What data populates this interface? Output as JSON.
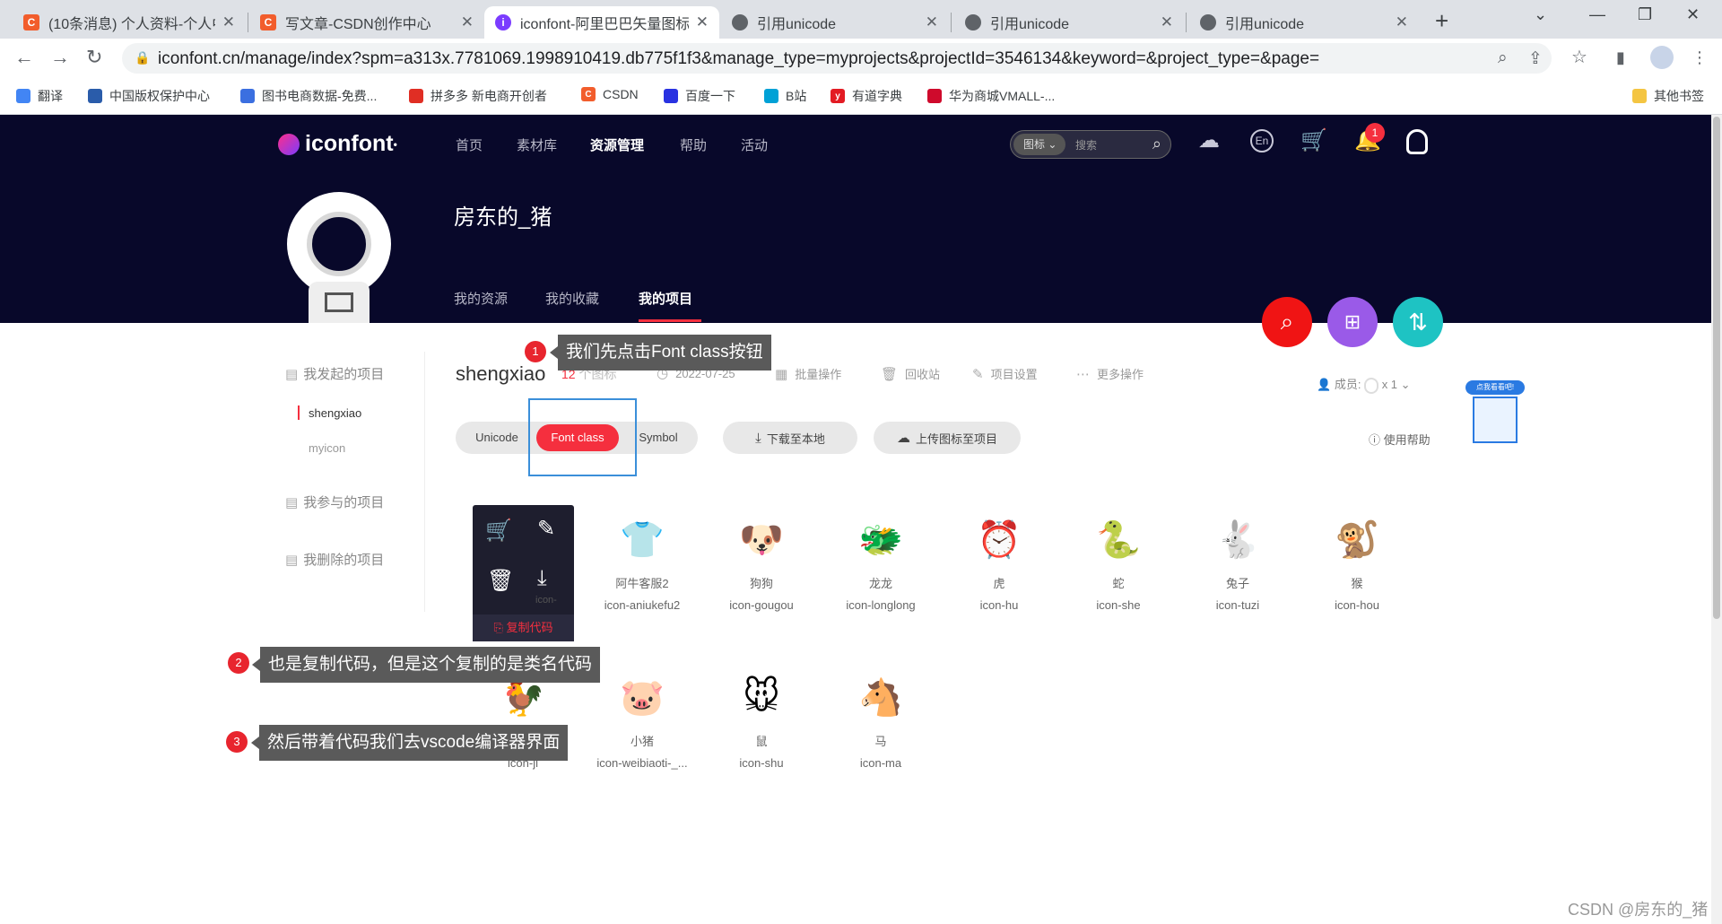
{
  "browser": {
    "tabs": [
      {
        "title": "(10条消息) 个人资料-个人中",
        "favicon": "C",
        "color": "#f25d2c"
      },
      {
        "title": "写文章-CSDN创作中心",
        "favicon": "C",
        "color": "#f25d2c"
      },
      {
        "title": "iconfont-阿里巴巴矢量图标",
        "favicon": "i",
        "color": "#7b3cff"
      },
      {
        "title": "引用unicode",
        "favicon": "globe",
        "color": "#5f6368"
      },
      {
        "title": "引用unicode",
        "favicon": "globe",
        "color": "#5f6368"
      },
      {
        "title": "引用unicode",
        "favicon": "globe",
        "color": "#5f6368"
      }
    ],
    "url": "iconfont.cn/manage/index?spm=a313x.7781069.1998910419.db775f1f3&manage_type=myprojects&projectId=3546134&keyword=&project_type=&page=",
    "bookmarks": [
      {
        "label": "翻译",
        "color": "#4285f4"
      },
      {
        "label": "中国版权保护中心",
        "color": "#2a5caa"
      },
      {
        "label": "图书电商数据-免费...",
        "color": "#3b6fe0"
      },
      {
        "label": "拼多多 新电商开创者",
        "color": "#e02e24"
      },
      {
        "label": "CSDN",
        "color": "#f25d2c"
      },
      {
        "label": "百度一下",
        "color": "#2932e1"
      },
      {
        "label": "B站",
        "color": "#00a1d6"
      },
      {
        "label": "有道字典",
        "color": "#e31b23"
      },
      {
        "label": "华为商城VMALL-...",
        "color": "#cf0a2c"
      }
    ],
    "other_bookmarks": "其他书签"
  },
  "site": {
    "logo": "iconfont",
    "nav": [
      "首页",
      "素材库",
      "资源管理",
      "帮助",
      "活动"
    ],
    "search_type": "图标",
    "search_placeholder": "搜索",
    "notification_count": "1",
    "username": "房东的_猪",
    "subtabs": [
      "我的资源",
      "我的收藏",
      "我的项目"
    ]
  },
  "sidebar": {
    "my_projects_header": "我发起的项目",
    "projects": [
      "shengxiao",
      "myicon"
    ],
    "joined_header": "我参与的项目",
    "deleted_header": "我删除的项目"
  },
  "project": {
    "name": "shengxiao",
    "count": "12",
    "count_unit": "个图标",
    "date": "2022-07-25",
    "actions": [
      "批量操作",
      "回收站",
      "项目设置",
      "更多操作"
    ],
    "members_label": "成员:",
    "members_count": "x 1",
    "help_badge": "点我看看吧!",
    "help_link": "使用帮助",
    "format_tabs": [
      "Unicode",
      "Font class",
      "Symbol"
    ],
    "download": "下载至本地",
    "upload": "上传图标至项目",
    "copy_code": "复制代码",
    "hidden_icon_code": "icon-"
  },
  "icons": [
    {
      "name": "阿牛客服2",
      "code": "icon-aniukefu2",
      "glyph": "👕",
      "color": "#555"
    },
    {
      "name": "狗狗",
      "code": "icon-gougou",
      "glyph": "🐶",
      "color": "#444"
    },
    {
      "name": "龙龙",
      "code": "icon-longlong",
      "glyph": "🐲",
      "color": "#4a7a9a"
    },
    {
      "name": "虎",
      "code": "icon-hu",
      "glyph": "⏰",
      "color": "#4aa8e8"
    },
    {
      "name": "蛇",
      "code": "icon-she",
      "glyph": "🐍",
      "color": "#3a7fd4"
    },
    {
      "name": "兔子",
      "code": "icon-tuzi",
      "glyph": "🐇",
      "color": "#6a7478"
    },
    {
      "name": "猴",
      "code": "icon-hou",
      "glyph": "🐒",
      "color": "#9a5a2a"
    },
    {
      "name": "鸡",
      "code": "icon-ji",
      "glyph": "🐓",
      "color": "#888"
    },
    {
      "name": "小猪",
      "code": "icon-weibiaoti-_...",
      "glyph": "🐷",
      "color": "#5cb85c"
    },
    {
      "name": "鼠",
      "code": "icon-shu",
      "glyph": "🐭",
      "color": "#e02020"
    },
    {
      "name": "马",
      "code": "icon-ma",
      "glyph": "🐴",
      "color": "#7a5ac8"
    }
  ],
  "annotations": [
    {
      "num": "1",
      "text": "我们先点击Font class按钮"
    },
    {
      "num": "2",
      "text": "也是复制代码，但是这个复制的是类名代码"
    },
    {
      "num": "3",
      "text": "然后带着代码我们去vscode编译器界面"
    }
  ],
  "watermark": "CSDN @房东的_猪"
}
